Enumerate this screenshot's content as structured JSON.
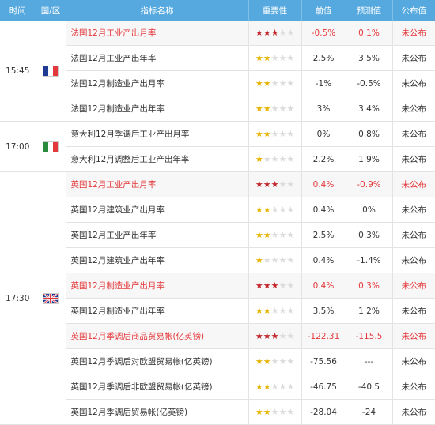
{
  "header": {
    "time": "时间",
    "country": "国/区",
    "indicator": "指标名称",
    "importance": "重要性",
    "previous": "前值",
    "forecast": "预测值",
    "actual": "公布值"
  },
  "groups": [
    {
      "time": "15:45",
      "flag": "france-flag-icon",
      "rows": [
        {
          "name": "法国12月工业产出月率",
          "stars": 3,
          "prev": "-0.5%",
          "forecast": "0.1%",
          "actual": "未公布",
          "highlight": true
        },
        {
          "name": "法国12月工业产出年率",
          "stars": 2,
          "prev": "2.5%",
          "forecast": "3.5%",
          "actual": "未公布",
          "highlight": false
        },
        {
          "name": "法国12月制造业产出月率",
          "stars": 2,
          "prev": "-1%",
          "forecast": "-0.5%",
          "actual": "未公布",
          "highlight": false
        },
        {
          "name": "法国12月制造业产出年率",
          "stars": 2,
          "prev": "3%",
          "forecast": "3.4%",
          "actual": "未公布",
          "highlight": false
        }
      ]
    },
    {
      "time": "17:00",
      "flag": "italy-flag-icon",
      "rows": [
        {
          "name": "意大利12月季调后工业产出月率",
          "stars": 2,
          "prev": "0%",
          "forecast": "0.8%",
          "actual": "未公布",
          "highlight": false
        },
        {
          "name": "意大利12月调整后工业产出年率",
          "stars": 1,
          "prev": "2.2%",
          "forecast": "1.9%",
          "actual": "未公布",
          "highlight": false
        }
      ]
    },
    {
      "time": "17:30",
      "flag": "uk-flag-icon",
      "rows": [
        {
          "name": "英国12月工业产出月率",
          "stars": 3,
          "prev": "0.4%",
          "forecast": "-0.9%",
          "actual": "未公布",
          "highlight": true
        },
        {
          "name": "英国12月建筑业产出月率",
          "stars": 2,
          "prev": "0.4%",
          "forecast": "0%",
          "actual": "未公布",
          "highlight": false
        },
        {
          "name": "英国12月工业产出年率",
          "stars": 2,
          "prev": "2.5%",
          "forecast": "0.3%",
          "actual": "未公布",
          "highlight": false
        },
        {
          "name": "英国12月建筑业产出年率",
          "stars": 1,
          "prev": "0.4%",
          "forecast": "-1.4%",
          "actual": "未公布",
          "highlight": false
        },
        {
          "name": "英国12月制造业产出月率",
          "stars": 3,
          "prev": "0.4%",
          "forecast": "0.3%",
          "actual": "未公布",
          "highlight": true
        },
        {
          "name": "英国12月制造业产出年率",
          "stars": 2,
          "prev": "3.5%",
          "forecast": "1.2%",
          "actual": "未公布",
          "highlight": false
        },
        {
          "name": "英国12月季调后商品贸易帐(亿英镑)",
          "stars": 3,
          "prev": "-122.31",
          "forecast": "-115.5",
          "actual": "未公布",
          "highlight": true
        },
        {
          "name": "英国12月季调后对欧盟贸易帐(亿英镑)",
          "stars": 2,
          "prev": "-75.56",
          "forecast": "---",
          "actual": "未公布",
          "highlight": false
        },
        {
          "name": "英国12月季调后非欧盟贸易帐(亿英镑)",
          "stars": 2,
          "prev": "-46.75",
          "forecast": "-40.5",
          "actual": "未公布",
          "highlight": false
        },
        {
          "name": "英国12月季调后贸易帐(亿英镑)",
          "stars": 2,
          "prev": "-28.04",
          "forecast": "-24",
          "actual": "未公布",
          "highlight": false
        }
      ]
    }
  ],
  "max_stars": 5,
  "colors": {
    "header_bg": "#55a9df",
    "highlight_text": "#e4393c",
    "star_gold": "#e6b400",
    "star_red": "#c1272d"
  }
}
